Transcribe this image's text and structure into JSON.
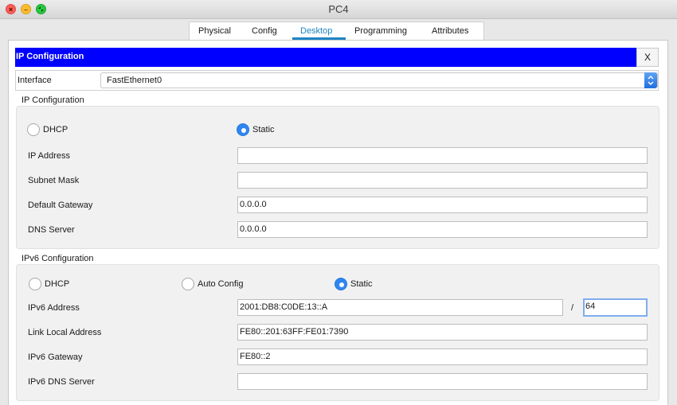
{
  "window": {
    "title": "PC4"
  },
  "tabs": [
    {
      "label": "Physical",
      "active": false
    },
    {
      "label": "Config",
      "active": false
    },
    {
      "label": "Desktop",
      "active": true
    },
    {
      "label": "Programming",
      "active": false
    },
    {
      "label": "Attributes",
      "active": false
    }
  ],
  "header": {
    "title": "IP Configuration",
    "close_label": "X"
  },
  "interface": {
    "label": "Interface",
    "selected": "FastEthernet0"
  },
  "ipv4": {
    "section_label": "IP Configuration",
    "mode_options": [
      "DHCP",
      "Static"
    ],
    "selected_mode": "Static",
    "fields": {
      "ip_address": {
        "label": "IP Address",
        "value": ""
      },
      "subnet_mask": {
        "label": "Subnet Mask",
        "value": ""
      },
      "default_gateway": {
        "label": "Default Gateway",
        "value": "0.0.0.0"
      },
      "dns_server": {
        "label": "DNS Server",
        "value": "0.0.0.0"
      }
    }
  },
  "ipv6": {
    "section_label": "IPv6 Configuration",
    "mode_options": [
      "DHCP",
      "Auto Config",
      "Static"
    ],
    "selected_mode": "Static",
    "fields": {
      "address": {
        "label": "IPv6 Address",
        "value": "2001:DB8:C0DE:13::A"
      },
      "prefix_separator": "/",
      "prefix_length": "64",
      "link_local": {
        "label": "Link Local Address",
        "value": "FE80::201:63FF:FE01:7390"
      },
      "gateway": {
        "label": "IPv6 Gateway",
        "value": "FE80::2"
      },
      "dns_server": {
        "label": "IPv6 DNS Server",
        "value": ""
      }
    }
  },
  "colors": {
    "header_bar": "#0000ff",
    "active_tab": "#1f84c4",
    "radio_selected": "#2f86f1"
  }
}
